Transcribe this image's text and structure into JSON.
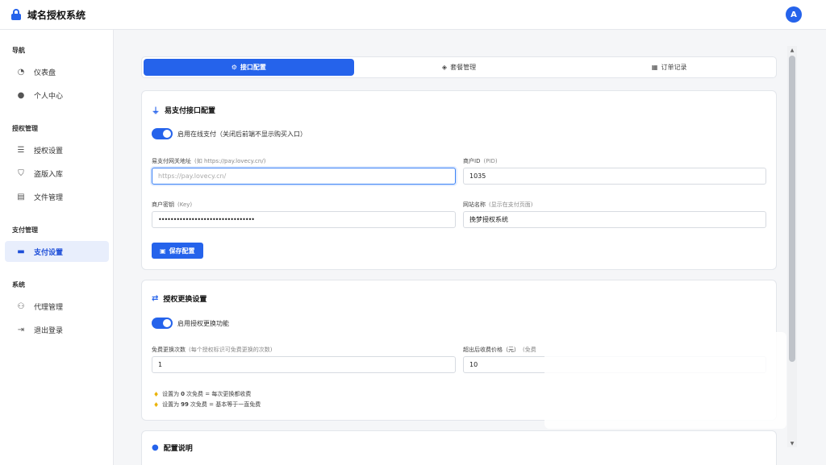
{
  "app": {
    "title": "域名授权系统",
    "avatar_letter": "A"
  },
  "sidebar": {
    "sections": [
      {
        "label": "导航"
      },
      {
        "label": "授权管理"
      },
      {
        "label": "支付管理"
      },
      {
        "label": "系统"
      }
    ],
    "items": [
      {
        "label": "仪表盘",
        "icon": "dashboard-icon"
      },
      {
        "label": "个人中心",
        "icon": "user-icon"
      },
      {
        "label": "授权设置",
        "icon": "sliders-icon"
      },
      {
        "label": "盗版入库",
        "icon": "shield-icon"
      },
      {
        "label": "文件管理",
        "icon": "file-icon"
      },
      {
        "label": "支付设置",
        "icon": "credit-card-icon",
        "active": true
      },
      {
        "label": "代理管理",
        "icon": "users-icon"
      },
      {
        "label": "退出登录",
        "icon": "logout-icon"
      }
    ]
  },
  "tabs": [
    {
      "label": "接口配置",
      "icon": "gear-icon",
      "active": true
    },
    {
      "label": "套餐管理",
      "icon": "tag-icon"
    },
    {
      "label": "订单记录",
      "icon": "receipt-icon"
    }
  ],
  "pay_card": {
    "title": "易支付接口配置",
    "toggle_label": "启用在线支付（关闭后前端不显示购买入口）",
    "gateway": {
      "label": "易支付网关地址",
      "hint": "(如 https://pay.lovecy.cn/)",
      "placeholder": "https://pay.lovecy.cn/",
      "value": ""
    },
    "pid": {
      "label": "商户ID",
      "hint": "(PID)",
      "value": "1035"
    },
    "key": {
      "label": "商户密钥",
      "hint": "(Key)",
      "value": "••••••••••••••••••••••••••••••••"
    },
    "site_name": {
      "label": "网站名称",
      "hint": "(显示在支付页面)",
      "value": "挽梦授权系统"
    },
    "save_label": "保存配置"
  },
  "change_card": {
    "title": "授权更换设置",
    "toggle_label": "启用授权更换功能",
    "free_times": {
      "label": "免费更换次数",
      "hint": "(每个授权标识可免费更换的次数)",
      "value": "1"
    },
    "price": {
      "label": "超出后收费价格（元）",
      "hint": "(免费",
      "value": "10"
    },
    "tip1": {
      "prefix": "设置为",
      "num": "0",
      "suffix": "次免费 = 每次更换都收费"
    },
    "tip2": {
      "prefix": "设置为",
      "num": "99",
      "suffix": "次免费 = 基本等于一直免费"
    }
  },
  "config_card": {
    "title": "配置说明"
  }
}
